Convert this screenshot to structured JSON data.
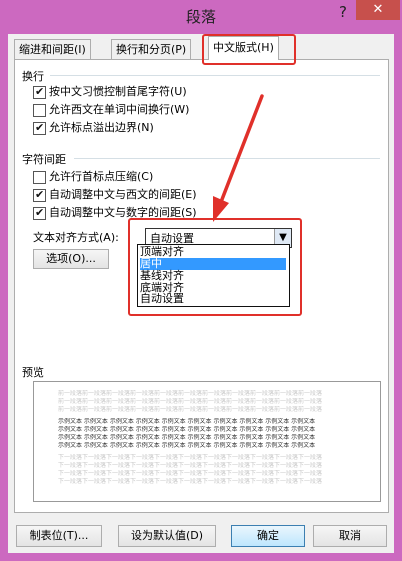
{
  "window": {
    "title": "段落",
    "help": "?",
    "close": "✕"
  },
  "tabs": [
    {
      "label": "缩进和间距(I)"
    },
    {
      "label": "换行和分页(P)"
    },
    {
      "label": "中文版式(H)"
    }
  ],
  "line_break": {
    "heading": "换行",
    "options": [
      {
        "label": "按中文习惯控制首尾字符(U)",
        "checked": true
      },
      {
        "label": "允许西文在单词中间换行(W)",
        "checked": false
      },
      {
        "label": "允许标点溢出边界(N)",
        "checked": true
      }
    ]
  },
  "char_spacing": {
    "heading": "字符间距",
    "options": [
      {
        "label": "允许行首标点压缩(C)",
        "checked": false
      },
      {
        "label": "自动调整中文与西文的间距(E)",
        "checked": true
      },
      {
        "label": "自动调整中文与数字的间距(S)",
        "checked": true
      }
    ]
  },
  "text_align": {
    "label": "文本对齐方式(A):",
    "selected": "自动设置",
    "options": [
      "顶端对齐",
      "居中",
      "基线对齐",
      "底端对齐",
      "自动设置"
    ],
    "highlighted": "居中"
  },
  "options_button": "选项(O)...",
  "preview": {
    "heading": "预览",
    "prev_text": "前一段落前一段落前一段落前一段落前一段落前一段落前一段落前一段落前一段落前一段落前一段落",
    "sample_text": "示例文本 示例文本 示例文本 示例文本 示例文本 示例文本 示例文本 示例文本 示例文本 示例文本",
    "next_text": "下一段落下一段落下一段落下一段落下一段落下一段落下一段落下一段落下一段落下一段落下一段落"
  },
  "footer": {
    "tabs_button": "制表位(T)...",
    "default_button": "设为默认值(D)",
    "ok_button": "确定",
    "cancel_button": "取消"
  },
  "colors": {
    "window_frame": "#cc69c0",
    "annotation": "#e0302a",
    "highlight": "#3399ff"
  }
}
